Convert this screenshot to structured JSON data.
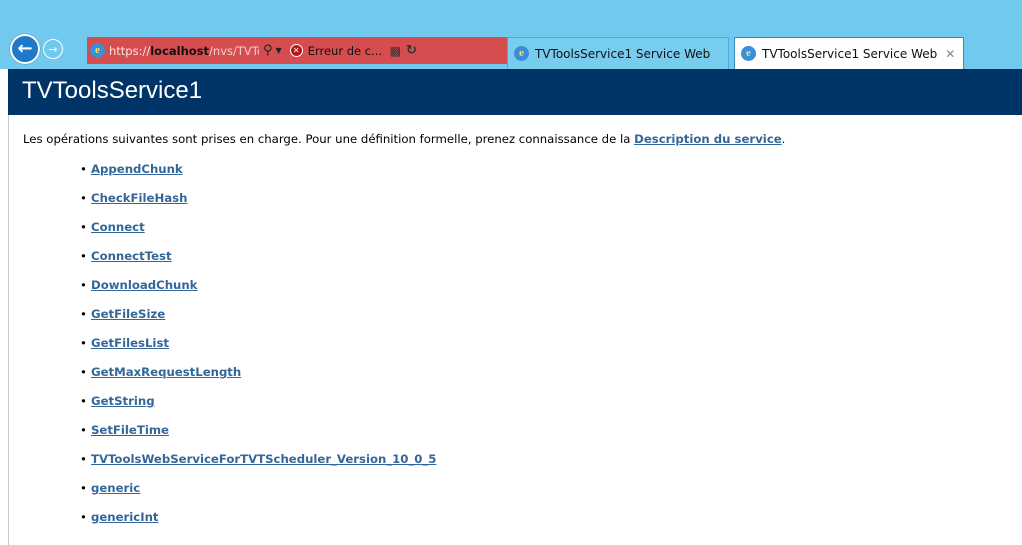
{
  "browser": {
    "address": {
      "url_proto": "https://",
      "url_host": "localhost",
      "url_path": "/nvs/TVToolsWebS",
      "cert_error": "Erreur de c..."
    },
    "tabs": [
      {
        "label": "TVToolsService1 Service Web",
        "active": false
      },
      {
        "label": "TVToolsService1 Service Web",
        "active": true
      }
    ],
    "icons": {
      "back": "back-arrow-icon",
      "forward": "forward-arrow-icon",
      "site": "ie-page-icon",
      "search": "search-icon",
      "cert_error": "certificate-error-icon",
      "compat": "compatibility-view-icon",
      "refresh": "refresh-icon",
      "close": "close-icon"
    }
  },
  "page": {
    "title": "TVToolsService1",
    "intro_text": "Les opérations suivantes sont prises en charge. Pour une définition formelle, prenez connaissance de la ",
    "intro_link": "Description du service",
    "intro_end": ".",
    "operations": [
      "AppendChunk",
      "CheckFileHash",
      "Connect",
      "ConnectTest",
      "DownloadChunk",
      "GetFileSize",
      "GetFilesList",
      "GetMaxRequestLength",
      "GetString",
      "SetFileTime",
      "TVToolsWebServiceForTVTScheduler_Version_10_0_5",
      "generic",
      "genericInt"
    ]
  },
  "colors": {
    "chrome_bg": "#71c9ee",
    "address_error_bg": "#d64d4f",
    "header_bg": "#003366",
    "link": "#336699"
  }
}
